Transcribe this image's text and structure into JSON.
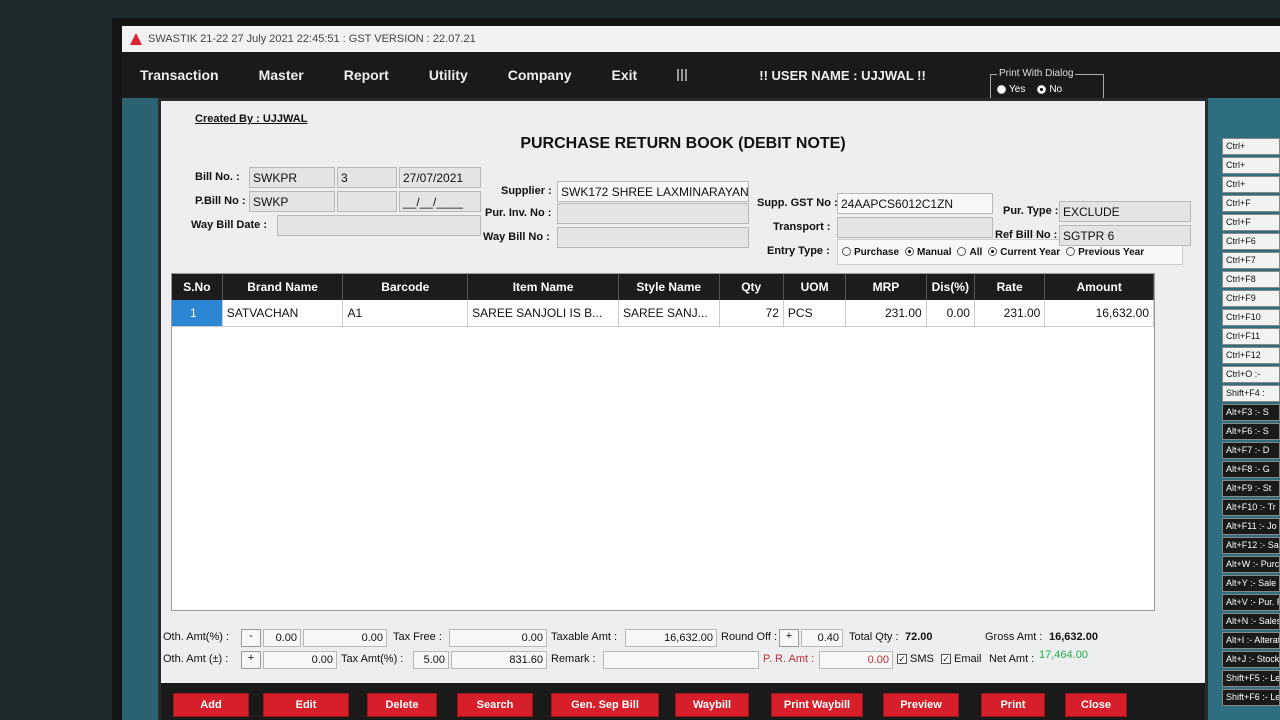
{
  "titlebar": {
    "text": "SWASTIK 21-22   27 July 2021  22:45:51 : GST VERSION : 22.07.21"
  },
  "menu": {
    "items": [
      "Transaction",
      "Master",
      "Report",
      "Utility",
      "Company",
      "Exit"
    ],
    "user_name": "!! USER NAME  : UJJWAL !!"
  },
  "print_dialog": {
    "legend": "Print With Dialog",
    "yes": "Yes",
    "no": "No",
    "selected": "No"
  },
  "form": {
    "created_by": "Created By : UJJWAL",
    "title": "PURCHASE RETURN BOOK  (DEBIT NOTE)",
    "bill_no_label": "Bill No. :",
    "bill_no_prefix": "SWKPR",
    "bill_no": "3",
    "bill_date": "27/07/2021",
    "pbill_no_label": "P.Bill No :",
    "pbill_no_prefix": "SWKP",
    "pbill_no": "",
    "pbill_date": "__/__/____",
    "way_bill_date_label": "Way Bill Date :",
    "way_bill_date": "",
    "supplier_label": "Supplier :",
    "supplier": "SWK172 SHREE LAXMINARAYAN",
    "pur_inv_label": "Pur. Inv. No :",
    "pur_inv": "",
    "way_bill_no_label": "Way Bill No :",
    "way_bill_no": "",
    "supp_gst_label": "Supp. GST No :",
    "supp_gst": "24AAPCS6012C1ZN",
    "transport_label": "Transport :",
    "transport": "",
    "entry_type_label": "Entry Type :",
    "entry_types": [
      "Purchase",
      "Manual",
      "All"
    ],
    "entry_type_selected": "Manual",
    "year_types": [
      "Current Year",
      "Previous Year"
    ],
    "year_selected": "Current Year",
    "pur_type_label": "Pur. Type :",
    "pur_type": "EXCLUDE",
    "ref_bill_label": "Ref Bill No :",
    "ref_bill": "SGTPR 6"
  },
  "grid": {
    "headers": [
      "S.No",
      "Brand Name",
      "Barcode",
      "Item Name",
      "Style Name",
      "Qty",
      "UOM",
      "MRP",
      "Dis(%)",
      "Rate",
      "Amount"
    ],
    "rows": [
      [
        "1",
        "SATVACHAN",
        "A1",
        "SAREE SANJOLI IS B...",
        "SAREE SANJ...",
        "72",
        "PCS",
        "231.00",
        "0.00",
        "231.00",
        "16,632.00"
      ]
    ]
  },
  "totals": {
    "oth_amt_pct_label": "Oth. Amt(%) :",
    "oth_amt_pct_sign": "-",
    "oth_amt_pct": "0.00",
    "oth_amt_pct_val": "0.00",
    "oth_amt_label": "Oth. Amt (±) :",
    "oth_amt_sign": "+",
    "oth_amt": "0.00",
    "tax_free_label": "Tax Free :",
    "tax_free": "0.00",
    "tax_amt_label": "Tax Amt(%) :",
    "tax_pct": "5.00",
    "tax_amt": "831.60",
    "taxable_label": "Taxable Amt :",
    "taxable": "16,632.00",
    "remark_label": "Remark :",
    "remark": "",
    "round_off_label": "Round Off :",
    "round_sign": "+",
    "round_off": "0.40",
    "pr_amt_label": "P. R. Amt :",
    "pr_amt": "0.00",
    "total_qty_label": "Total Qty :",
    "total_qty": "72.00",
    "sms_label": "SMS",
    "email_label": "Email",
    "gross_label": "Gross Amt :",
    "gross": "16,632.00",
    "net_label": "Net Amt :",
    "net": "17,464.00"
  },
  "buttons": [
    "Add",
    "Edit",
    "Delete",
    "Search",
    "Gen. Sep Bill",
    "Waybill",
    "Print Waybill",
    "Preview",
    "Print",
    "Close"
  ],
  "shortcuts": [
    "Ctrl+",
    "Ctrl+",
    "Ctrl+",
    "Ctrl+F",
    "Ctrl+F",
    "Ctrl+F6",
    "Ctrl+F7",
    "Ctrl+F8",
    "Ctrl+F9",
    "Ctrl+F10",
    "Ctrl+F11",
    "Ctrl+F12",
    "Ctrl+O :-",
    "Shift+F4 :",
    "Alt+F3 :- S",
    "Alt+F6 :- S",
    "Alt+F7 :- D",
    "Alt+F8 :- G",
    "Alt+F9 :- St",
    "Alt+F10 :- Tr",
    "Alt+F11 :- Jo",
    "Alt+F12 :- Sa",
    "Alt+W :- Purc",
    "Alt+Y :- Sale",
    "Alt+V :- Pur. R",
    "Alt+N :- Sales",
    "Alt+I :- Alterat",
    "Alt+J :- Stock",
    "Shift+F5 :- Led",
    "Shift+F6 :- Led"
  ]
}
